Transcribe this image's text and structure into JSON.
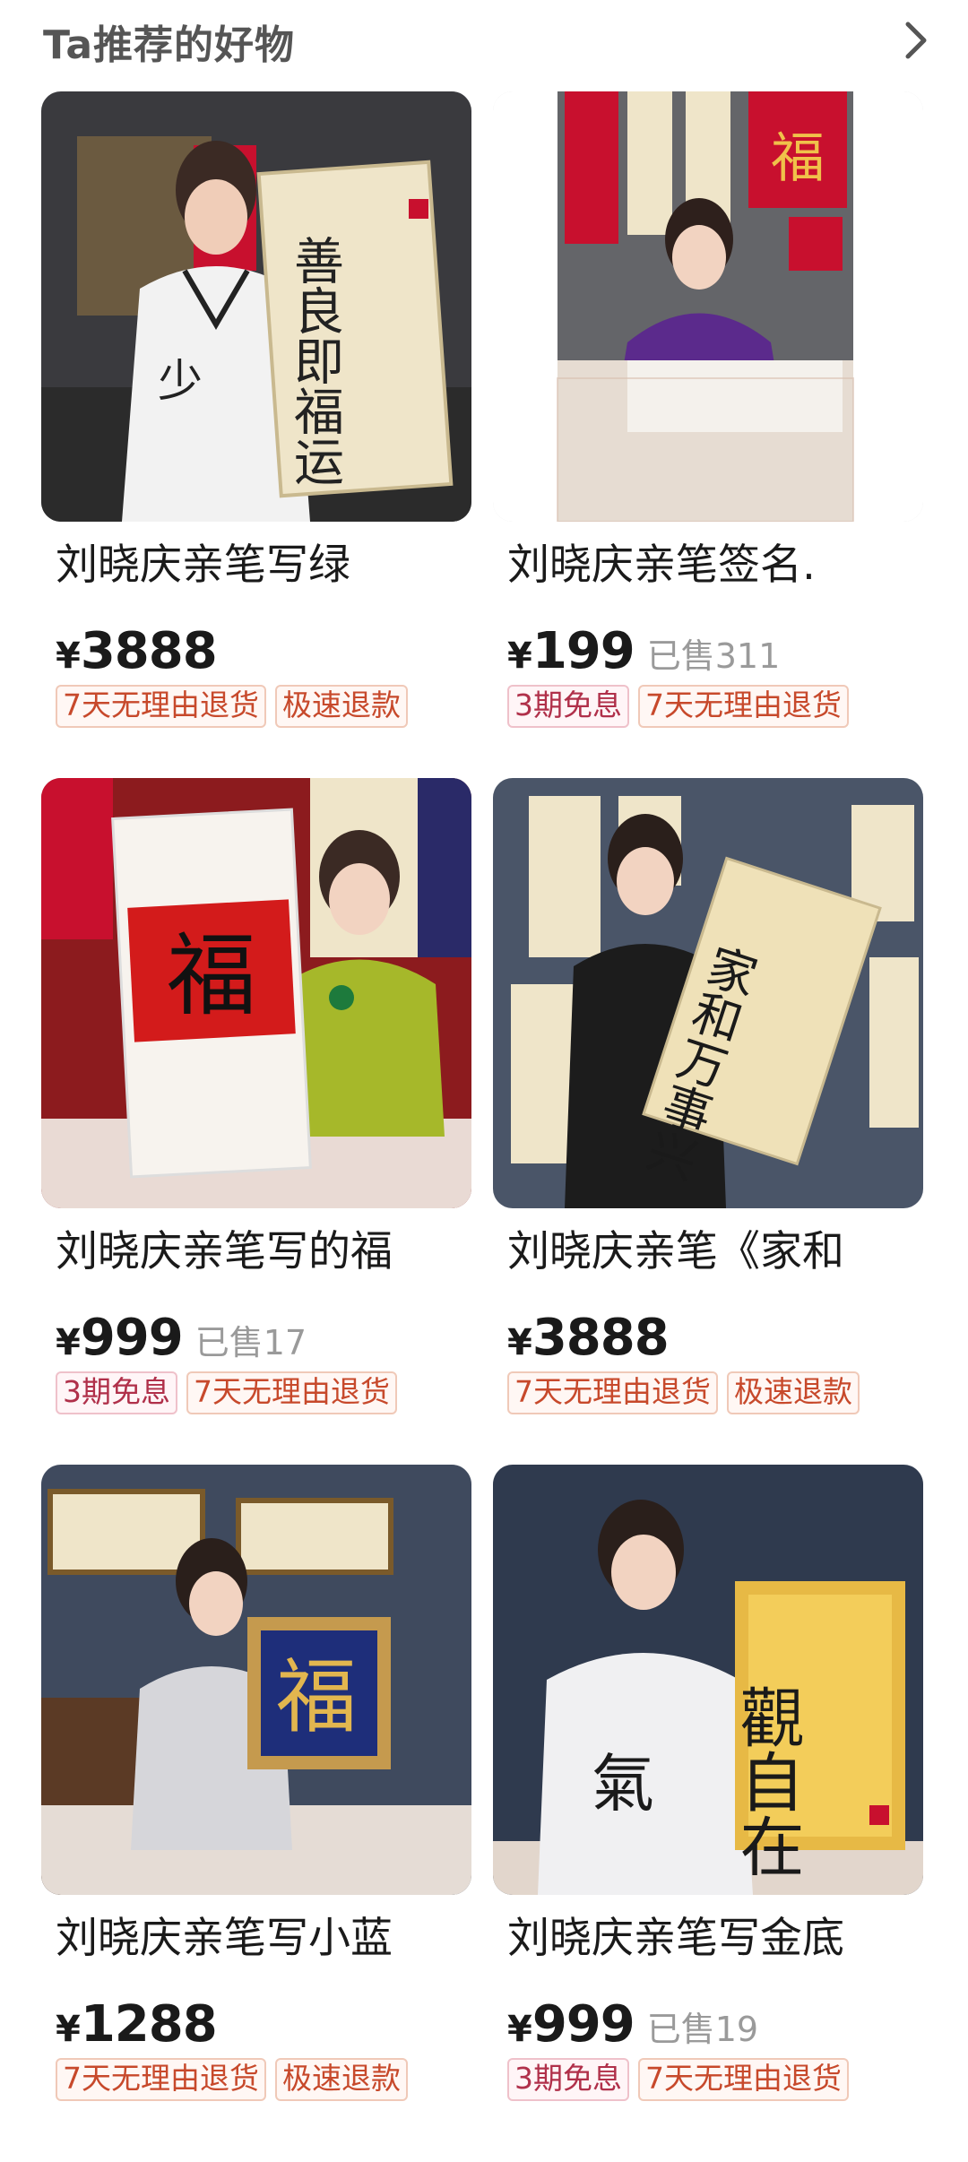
{
  "header": {
    "title": "Ta推荐的好物",
    "more_icon": "chevron-right-icon"
  },
  "products": [
    {
      "title": "刘晓庆亲笔写绿",
      "currency": "¥",
      "price": "3888",
      "sold": "",
      "tags": [
        "7天无理由退货",
        "极速退款"
      ],
      "image_desc": "woman holding vertical calligraphy scroll",
      "image_text": "善良即福运"
    },
    {
      "title": "刘晓庆亲笔签名.",
      "currency": "¥",
      "price": "199",
      "sold": "已售311",
      "tags": [
        "3期免息",
        "7天无理由退货"
      ],
      "image_desc": "woman in purple writing at desk with red couplets",
      "image_text": "福"
    },
    {
      "title": "刘晓庆亲笔写的福",
      "currency": "¥",
      "price": "999",
      "sold": "已售17",
      "tags": [
        "3期免息",
        "7天无理由退货"
      ],
      "image_desc": "woman holding red fu character poster",
      "image_text": "福"
    },
    {
      "title": "刘晓庆亲笔《家和",
      "currency": "¥",
      "price": "3888",
      "sold": "",
      "tags": [
        "7天无理由退货",
        "极速退款"
      ],
      "image_desc": "woman holding diagonal calligraphy scroll",
      "image_text": "家和万事兴"
    },
    {
      "title": "刘晓庆亲笔写小蓝",
      "currency": "¥",
      "price": "1288",
      "sold": "",
      "tags": [
        "7天无理由退货",
        "极速退款"
      ],
      "image_desc": "woman holding small blue framed fu",
      "image_text": "福"
    },
    {
      "title": "刘晓庆亲笔写金底",
      "currency": "¥",
      "price": "999",
      "sold": "已售19",
      "tags": [
        "3期免息",
        "7天无理由退货"
      ],
      "image_desc": "woman holding gold framed calligraphy",
      "image_text": "觀自在"
    }
  ]
}
